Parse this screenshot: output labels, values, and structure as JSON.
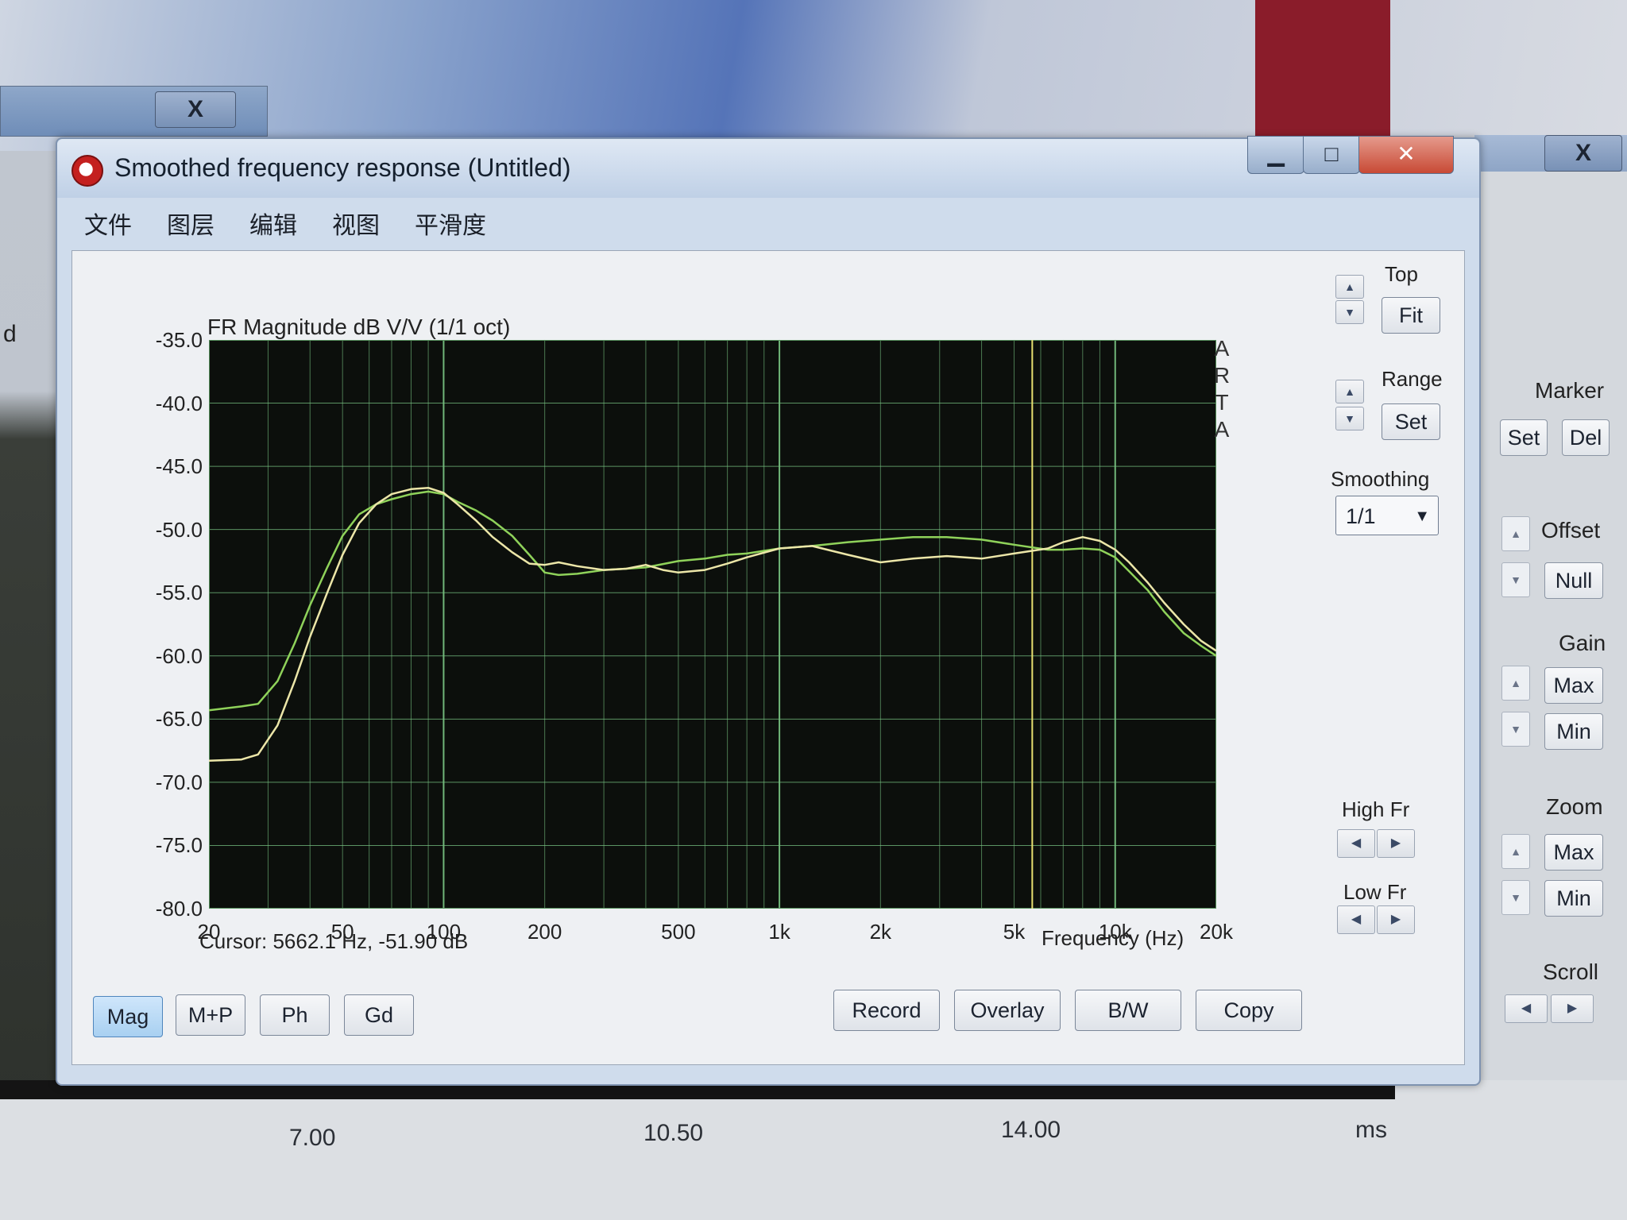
{
  "window": {
    "title": "Smoothed frequency response (Untitled)",
    "minimize_icon": "minimize-icon",
    "maximize_icon": "maximize-icon",
    "close_icon": "close-icon"
  },
  "menu": [
    "文件",
    "图层",
    "编辑",
    "视图",
    "平滑度"
  ],
  "background": {
    "close_glyph": "X",
    "ms_ticks": [
      "7.00",
      "10.50",
      "14.00"
    ],
    "ms_unit": "ms",
    "side_left_label": "d"
  },
  "plot": {
    "brand_letters": [
      "A",
      "R",
      "T",
      "A"
    ],
    "cursor_readout": "Cursor: 5662.1 Hz, -51.90 dB",
    "background_color": "#0c0f0c",
    "grid_color": "#76c080",
    "cursor_color": "#e8e070"
  },
  "chart_data": {
    "type": "line",
    "title": "FR Magnitude dB V/V (1/1 oct)",
    "xlabel": "Frequency (Hz)",
    "ylabel": "",
    "x_scale": "log",
    "xlim": [
      20,
      20000
    ],
    "ylim": [
      -80,
      -35
    ],
    "x_ticks": [
      20,
      50,
      100,
      200,
      500,
      1000,
      2000,
      5000,
      10000,
      20000
    ],
    "x_tick_labels": [
      "20",
      "50",
      "100",
      "200",
      "500",
      "1k",
      "2k",
      "5k",
      "10k",
      "20k"
    ],
    "y_ticks": [
      -35,
      -40,
      -45,
      -50,
      -55,
      -60,
      -65,
      -70,
      -75,
      -80
    ],
    "y_tick_labels": [
      "-35.0",
      "-40.0",
      "-45.0",
      "-50.0",
      "-55.0",
      "-60.0",
      "-65.0",
      "-70.0",
      "-75.0",
      "-80.0"
    ],
    "cursor_x": 5662.1,
    "series": [
      {
        "color": "#8fd25a",
        "x": [
          20,
          25,
          28,
          32,
          36,
          40,
          45,
          50,
          56,
          63,
          70,
          80,
          90,
          100,
          110,
          125,
          140,
          160,
          180,
          200,
          220,
          250,
          300,
          350,
          400,
          500,
          600,
          700,
          800,
          1000,
          1250,
          1600,
          2000,
          2500,
          3150,
          4000,
          5000,
          6300,
          7000,
          8000,
          9000,
          10000,
          11000,
          12500,
          14000,
          16000,
          18000,
          20000
        ],
        "y": [
          -64.3,
          -64.0,
          -63.8,
          -62.0,
          -59.0,
          -56.0,
          -53.0,
          -50.5,
          -48.8,
          -48.0,
          -47.6,
          -47.2,
          -47.0,
          -47.2,
          -47.8,
          -48.5,
          -49.3,
          -50.5,
          -52.0,
          -53.4,
          -53.6,
          -53.5,
          -53.2,
          -53.1,
          -53.0,
          -52.5,
          -52.3,
          -52.0,
          -51.9,
          -51.5,
          -51.3,
          -51.0,
          -50.8,
          -50.6,
          -50.6,
          -50.8,
          -51.2,
          -51.6,
          -51.6,
          -51.5,
          -51.6,
          -52.2,
          -53.3,
          -54.8,
          -56.5,
          -58.2,
          -59.2,
          -60.0
        ]
      },
      {
        "color": "#ece6a8",
        "x": [
          20,
          25,
          28,
          32,
          36,
          40,
          45,
          50,
          56,
          63,
          70,
          80,
          90,
          100,
          110,
          125,
          140,
          160,
          180,
          200,
          220,
          250,
          300,
          350,
          400,
          450,
          500,
          600,
          700,
          800,
          1000,
          1250,
          1600,
          2000,
          2500,
          3150,
          4000,
          5000,
          6300,
          7000,
          8000,
          9000,
          10000,
          11000,
          12500,
          14000,
          16000,
          18000,
          20000
        ],
        "y": [
          -68.3,
          -68.2,
          -67.8,
          -65.5,
          -62.0,
          -58.5,
          -55.0,
          -52.0,
          -49.5,
          -48.0,
          -47.2,
          -46.8,
          -46.7,
          -47.1,
          -48.0,
          -49.3,
          -50.6,
          -51.8,
          -52.7,
          -52.8,
          -52.6,
          -52.9,
          -53.2,
          -53.1,
          -52.8,
          -53.2,
          -53.4,
          -53.2,
          -52.7,
          -52.2,
          -51.5,
          -51.3,
          -52.0,
          -52.6,
          -52.3,
          -52.1,
          -52.3,
          -51.9,
          -51.5,
          -51.0,
          -50.6,
          -50.9,
          -51.6,
          -52.6,
          -54.2,
          -55.8,
          -57.5,
          -58.8,
          -59.6
        ]
      }
    ]
  },
  "bottom_buttons": {
    "mag": "Mag",
    "mp": "M+P",
    "ph": "Ph",
    "gd": "Gd",
    "record": "Record",
    "overlay": "Overlay",
    "bw": "B/W",
    "copy": "Copy"
  },
  "side_panel": {
    "top_label": "Top",
    "fit": "Fit",
    "range_label": "Range",
    "set": "Set",
    "smoothing_label": "Smoothing",
    "smoothing_value": "1/1",
    "high_fr_label": "High Fr",
    "low_fr_label": "Low Fr"
  },
  "right_panel": {
    "marker_label": "Marker",
    "marker_set": "Set",
    "marker_del": "Del",
    "offset_label": "Offset",
    "null": "Null",
    "gain_label": "Gain",
    "gain_max": "Max",
    "gain_min": "Min",
    "zoom_label": "Zoom",
    "zoom_max": "Max",
    "zoom_min": "Min",
    "scroll_label": "Scroll"
  }
}
